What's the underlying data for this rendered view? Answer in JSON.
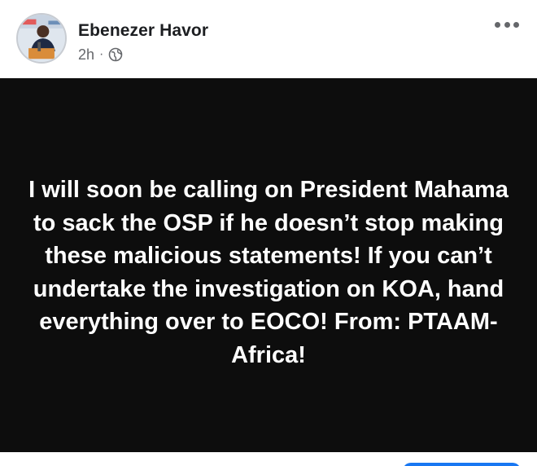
{
  "post": {
    "author_name": "Ebenezer Havor",
    "timestamp": "2h",
    "separator": "·",
    "audience_icon": "globe-icon",
    "text": "I will soon be calling on President Mahama to sack the OSP if he doesn’t stop making these malicious statements! If you can’t undertake the investigation on KOA, hand everything over to EOCO! From: PTAAM-Africa!"
  },
  "colors": {
    "card_background": "#0d0d0d",
    "card_text": "#ffffff",
    "meta_text": "#65676b",
    "accent": "#1877f2"
  }
}
